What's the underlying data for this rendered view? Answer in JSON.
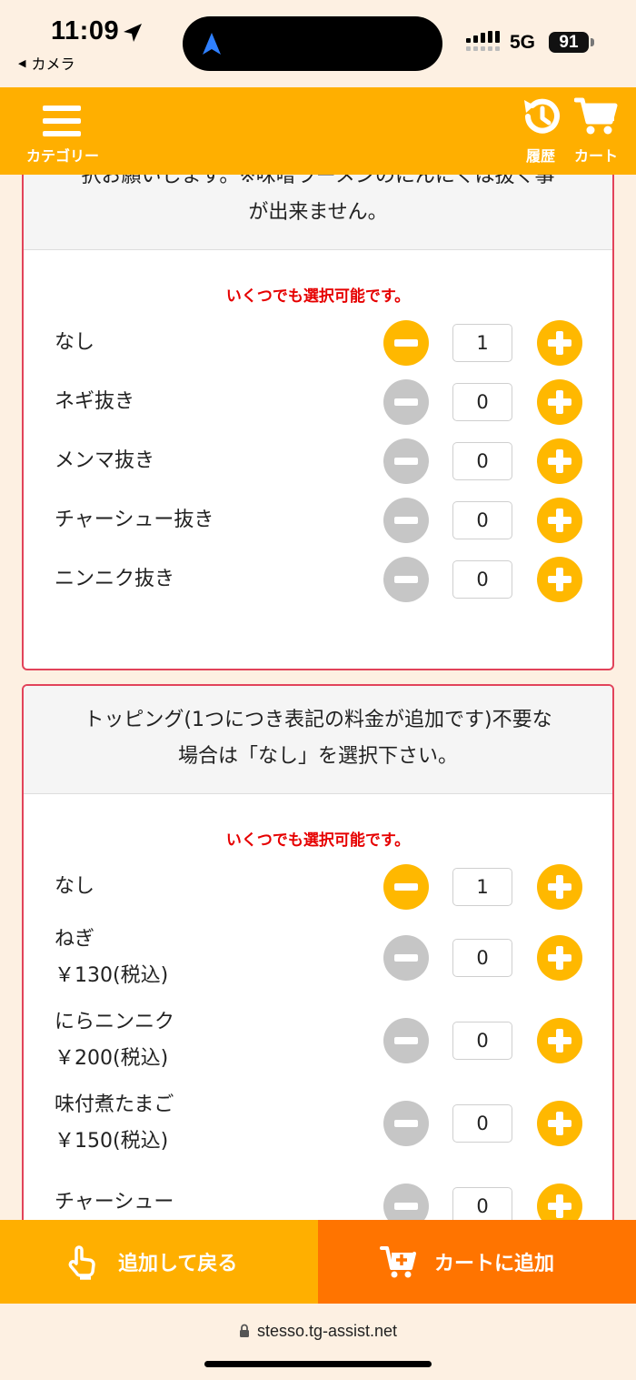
{
  "status_bar": {
    "time": "11:09",
    "back_app": "カメラ",
    "network": "5G",
    "battery": "91"
  },
  "header": {
    "menu_label": "カテゴリー",
    "history_label": "履歴",
    "cart_label": "カート"
  },
  "card1": {
    "title_lines": [
      "択お願いします。※味噌ラーメンのにんにくは抜く事",
      "が出来ません。"
    ],
    "hint": "いくつでも選択可能です。",
    "options": [
      {
        "label": "なし",
        "qty": "1",
        "minus_active": true
      },
      {
        "label": "ネギ抜き",
        "qty": "0",
        "minus_active": false
      },
      {
        "label": "メンマ抜き",
        "qty": "0",
        "minus_active": false
      },
      {
        "label": "チャーシュー抜き",
        "qty": "0",
        "minus_active": false
      },
      {
        "label": "ニンニク抜き",
        "qty": "0",
        "minus_active": false
      }
    ]
  },
  "card2": {
    "title_lines": [
      "トッピング(1つにつき表記の料金が追加です)不要な",
      "場合は「なし」を選択下さい。"
    ],
    "hint": "いくつでも選択可能です。",
    "options": [
      {
        "label": "なし",
        "price": "",
        "qty": "1",
        "minus_active": true
      },
      {
        "label": "ねぎ",
        "price": "￥130(税込)",
        "qty": "0",
        "minus_active": false
      },
      {
        "label": "にらニンニク",
        "price": "￥200(税込)",
        "qty": "0",
        "minus_active": false
      },
      {
        "label": "味付煮たまご",
        "price": "￥150(税込)",
        "qty": "0",
        "minus_active": false
      },
      {
        "label": "チャーシュー",
        "price": "",
        "qty": "0",
        "minus_active": false
      }
    ]
  },
  "actions": {
    "back_add_label": "追加して戻る",
    "add_cart_label": "カートに追加"
  },
  "browser": {
    "url": "stesso.tg-assist.net"
  },
  "colors": {
    "brand_orange": "#ffaf00",
    "cart_orange": "#ff7400",
    "hint_red": "#e60000",
    "card_border": "#e2435a",
    "background": "#fdf0e2"
  }
}
